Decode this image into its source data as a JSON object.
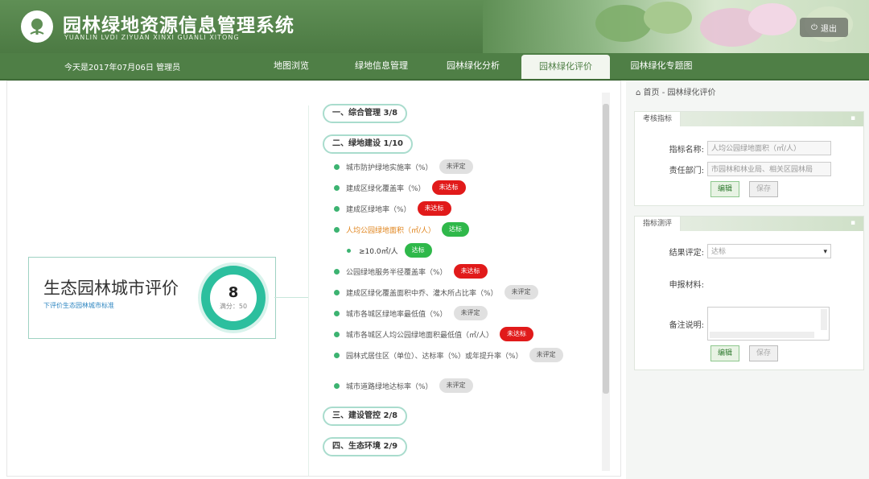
{
  "header": {
    "title": "园林绿地资源信息管理系统",
    "subtitle": "YUANLIN LVDI ZIYUAN XINXI GUANLI XITONG",
    "logout_label": "退出"
  },
  "nav": {
    "date_user": "今天是2017年07月06日 管理员",
    "tabs": [
      {
        "label": "地图浏览"
      },
      {
        "label": "绿地信息管理"
      },
      {
        "label": "园林绿化分析"
      },
      {
        "label": "园林绿化评价"
      },
      {
        "label": "园林绿化专题图"
      }
    ],
    "active_tab": "园林绿化评价"
  },
  "root": {
    "title": "生态园林城市评价",
    "link": "下评价生态园林城市标准",
    "score": "8",
    "full_score": "满分：50"
  },
  "categories": [
    {
      "label": "一、综合管理 3/8"
    },
    {
      "label": "二、绿地建设 1/10"
    },
    {
      "label": "三、建设管控 2/8"
    },
    {
      "label": "四、生态环境 2/9"
    }
  ],
  "items": [
    {
      "text": "城市防护绿地实施率（%）",
      "badge": "未评定",
      "badge_type": "grey"
    },
    {
      "text": "建成区绿化覆盖率（%）",
      "badge": "未达标",
      "badge_type": "red"
    },
    {
      "text": "建成区绿地率（%）",
      "badge": "未达标",
      "badge_type": "red"
    },
    {
      "text": "人均公园绿地面积（㎡/人）",
      "badge": "达标",
      "badge_type": "green"
    },
    {
      "text": "≥10.0㎡/人",
      "badge": "达标",
      "badge_type": "green"
    },
    {
      "text": "公园绿地服务半径覆盖率（%）",
      "badge": "未达标",
      "badge_type": "red"
    },
    {
      "text": "建成区绿化覆盖面积中乔、灌木所占比率（%）",
      "badge": "未评定",
      "badge_type": "grey"
    },
    {
      "text": "城市各城区绿地率最低值（%）",
      "badge": "未评定",
      "badge_type": "grey"
    },
    {
      "text": "城市各城区人均公园绿地面积最低值（㎡/人）",
      "badge": "未达标",
      "badge_type": "red"
    },
    {
      "text": "园林式居住区（单位）、达标率（%）或年提升率（%）",
      "badge": "未评定",
      "badge_type": "grey"
    },
    {
      "text": "城市道路绿地达标率（%）",
      "badge": "未评定",
      "badge_type": "grey"
    }
  ],
  "side": {
    "breadcrumb": "首页 - 园林绿化评价",
    "panel1": {
      "tab": "考核指标",
      "name_label": "指标名称:",
      "name_value": "人均公园绿地面积（㎡/人）",
      "dept_label": "责任部门:",
      "dept_value": "市园林和林业局、相关区园林局",
      "edit": "编辑",
      "save": "保存"
    },
    "panel2": {
      "tab": "指标测评",
      "result_label": "结果评定:",
      "result_value": "达标",
      "material_label": "申报材料:",
      "note_label": "备注说明:",
      "edit": "编辑",
      "save": "保存"
    }
  },
  "colors": {
    "header_green": "#4f7f46",
    "accent_teal": "#2cbf9e",
    "badge_red": "#e11a1a",
    "badge_green": "#2fb84a",
    "badge_grey": "#e0e0e0"
  }
}
